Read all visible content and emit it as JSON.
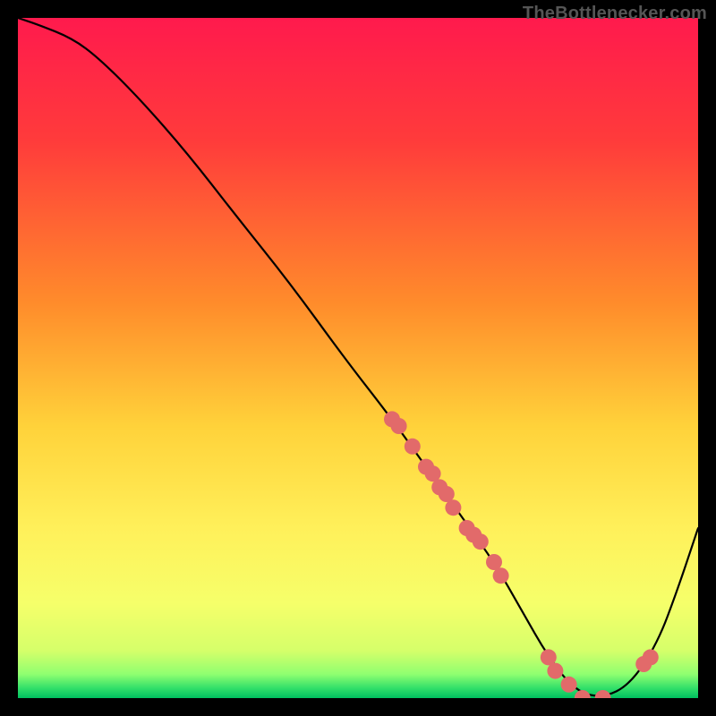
{
  "attribution": "TheBottlenecker.com",
  "chart_data": {
    "type": "line",
    "title": "",
    "xlabel": "",
    "ylabel": "",
    "xlim": [
      0,
      100
    ],
    "ylim": [
      0,
      100
    ],
    "series": [
      {
        "name": "curve",
        "x": [
          0,
          3,
          8,
          12,
          18,
          25,
          32,
          40,
          48,
          55,
          60,
          65,
          70,
          74,
          78,
          82,
          86,
          90,
          94,
          97,
          100
        ],
        "y": [
          100,
          99,
          97,
          94,
          88,
          80,
          71,
          61,
          50,
          41,
          34,
          27,
          20,
          13,
          6,
          1,
          0,
          2,
          8,
          16,
          25
        ]
      }
    ],
    "markers": {
      "x": [
        55,
        56,
        58,
        60,
        61,
        62,
        63,
        64,
        66,
        67,
        68,
        70,
        71,
        78,
        79,
        81,
        83,
        86,
        92,
        93
      ],
      "y": [
        41,
        40,
        37,
        34,
        33,
        31,
        30,
        28,
        25,
        24,
        23,
        20,
        18,
        6,
        4,
        2,
        0,
        0,
        5,
        6
      ]
    },
    "gradient_stops": [
      {
        "offset": 0,
        "color": "#ff1a4d"
      },
      {
        "offset": 0.18,
        "color": "#ff3b3b"
      },
      {
        "offset": 0.42,
        "color": "#ff8c2b"
      },
      {
        "offset": 0.6,
        "color": "#ffd23a"
      },
      {
        "offset": 0.75,
        "color": "#fff05a"
      },
      {
        "offset": 0.86,
        "color": "#f6ff6a"
      },
      {
        "offset": 0.93,
        "color": "#d6ff6a"
      },
      {
        "offset": 0.965,
        "color": "#8fff70"
      },
      {
        "offset": 0.985,
        "color": "#33e06a"
      },
      {
        "offset": 1.0,
        "color": "#00c060"
      }
    ],
    "colors": {
      "curve_stroke": "#000000",
      "marker_fill": "#e26a6a",
      "background": "#000000"
    }
  }
}
